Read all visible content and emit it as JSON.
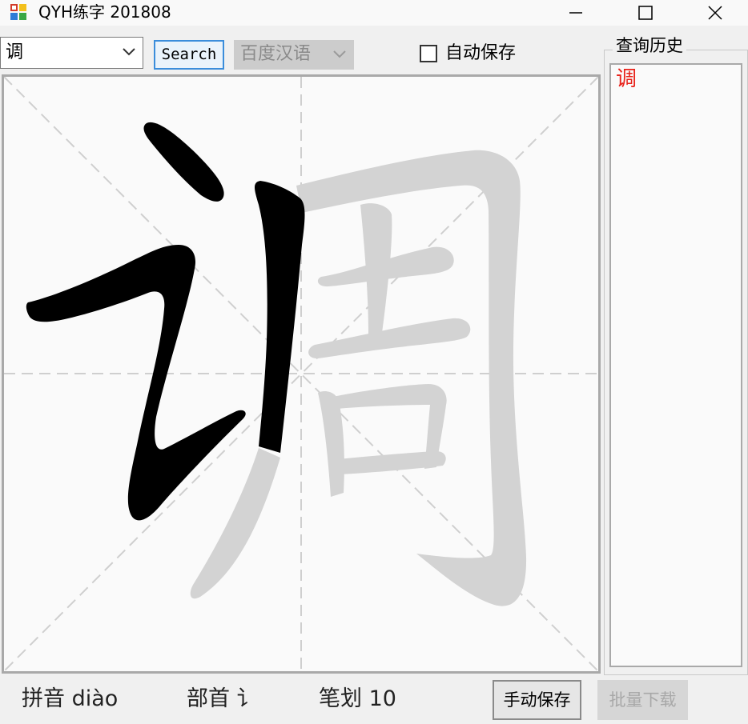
{
  "window": {
    "title": "QYH练字 201808",
    "minimize_icon": "minimize-icon",
    "maximize_icon": "maximize-icon",
    "close_icon": "close-icon"
  },
  "toolbar": {
    "char_input_value": "调",
    "search_label": "Search",
    "dictionary_selected": "百度汉语",
    "autosave_label": "自动保存",
    "autosave_checked": false
  },
  "canvas": {
    "character": "调",
    "strokes_total": 10,
    "strokes_drawn": 2,
    "drawn_color": "#000000",
    "remaining_color": "#d3d3d3",
    "guide_color": "#cfcfcf"
  },
  "history": {
    "title": "查询历史",
    "items": [
      "调"
    ],
    "item_color": "#e8221a"
  },
  "status": {
    "pinyin": "拼音 diào",
    "radical": "部首 讠",
    "strokes": "笔划 10"
  },
  "buttons": {
    "manual_save": "手动保存",
    "batch_download": "批量下载"
  }
}
